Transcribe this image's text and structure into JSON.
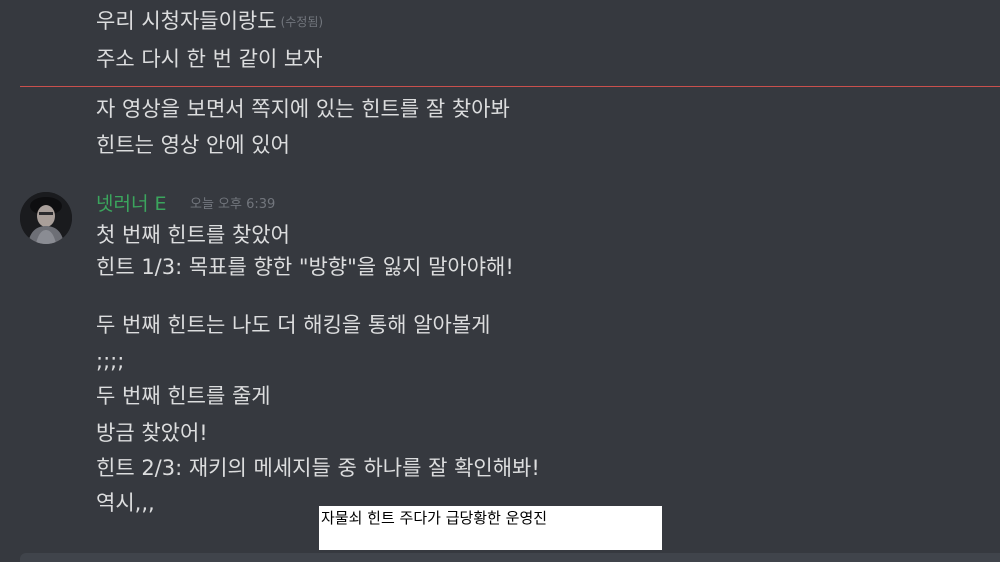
{
  "messages_above": [
    {
      "text": "우리 시청자들이랑도",
      "edited_label": "(수정됨)"
    },
    {
      "text": "주소 다시 한 번 같이 보자"
    }
  ],
  "messages_after_divider": [
    "자 영상을 보면서 쪽지에 있는 힌트를 잘 찾아봐",
    "힌트는 영상 안에 있어"
  ],
  "message_group": {
    "username": "넷러너 E",
    "timestamp": "오늘 오후 6:39",
    "lines": [
      "첫 번째 힌트를 찾았어",
      "힌트 1/3: 목표를 향한 \"방향\"을 잃지 말아야해!",
      "",
      "두 번째 힌트는 나도 더 해킹을 통해 알아볼게",
      ";;;;",
      "두 번째 힌트를 줄게",
      "방금 찾았어!",
      "힌트 2/3: 재키의 메세지들 중 하나를 잘 확인해봐!",
      "역시,,,"
    ]
  },
  "caption": "자물쇠 힌트 주다가 급당황한 운영진",
  "colors": {
    "background": "#36393f",
    "text": "#dcddde",
    "username": "#3ba55d",
    "timestamp": "#72767d",
    "new_messages_divider": "#d9534f"
  }
}
